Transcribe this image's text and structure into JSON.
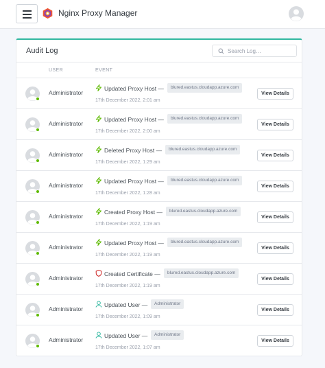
{
  "app": {
    "brand": "Nginx Proxy Manager"
  },
  "audit": {
    "title": "Audit Log",
    "search_placeholder": "Search Log…",
    "columns": {
      "user": "USER",
      "event": "EVENT"
    },
    "button_label": "View Details",
    "colors": {
      "accent": "#2fb79f",
      "proxy_icon": "#5eba00",
      "cert_icon": "#cd201f",
      "user_icon": "#2fb79f",
      "online_dot": "#5eba00"
    },
    "rows": [
      {
        "user": "Administrator",
        "icon": "lightning-icon",
        "action": "Updated Proxy Host —",
        "tag": "blured.eastus.cloudapp.azure.com",
        "date": "17th December 2022, 2:01 am"
      },
      {
        "user": "Administrator",
        "icon": "lightning-icon",
        "action": "Updated Proxy Host —",
        "tag": "blured.eastus.cloudapp.azure.com",
        "date": "17th December 2022, 2:00 am"
      },
      {
        "user": "Administrator",
        "icon": "lightning-icon",
        "action": "Deleted Proxy Host —",
        "tag": "blured.eastus.cloudapp.azure.com",
        "date": "17th December 2022, 1:29 am"
      },
      {
        "user": "Administrator",
        "icon": "lightning-icon",
        "action": "Updated Proxy Host —",
        "tag": "blured.eastus.cloudapp.azure.com",
        "date": "17th December 2022, 1:28 am"
      },
      {
        "user": "Administrator",
        "icon": "lightning-icon",
        "action": "Created Proxy Host —",
        "tag": "blured.eastus.cloudapp.azure.com",
        "date": "17th December 2022, 1:19 am"
      },
      {
        "user": "Administrator",
        "icon": "lightning-icon",
        "action": "Updated Proxy Host —",
        "tag": "blured.eastus.cloudapp.azure.com",
        "date": "17th December 2022, 1:19 am"
      },
      {
        "user": "Administrator",
        "icon": "shield-icon",
        "action": "Created Certificate —",
        "tag": "blured.eastus.cloudapp.azure.com",
        "date": "17th December 2022, 1:19 am"
      },
      {
        "user": "Administrator",
        "icon": "user-icon",
        "action": "Updated User —",
        "tag": "Administrator",
        "date": "17th December 2022, 1:09 am"
      },
      {
        "user": "Administrator",
        "icon": "user-icon",
        "action": "Updated User —",
        "tag": "Administrator",
        "date": "17th December 2022, 1:07 am"
      }
    ]
  }
}
